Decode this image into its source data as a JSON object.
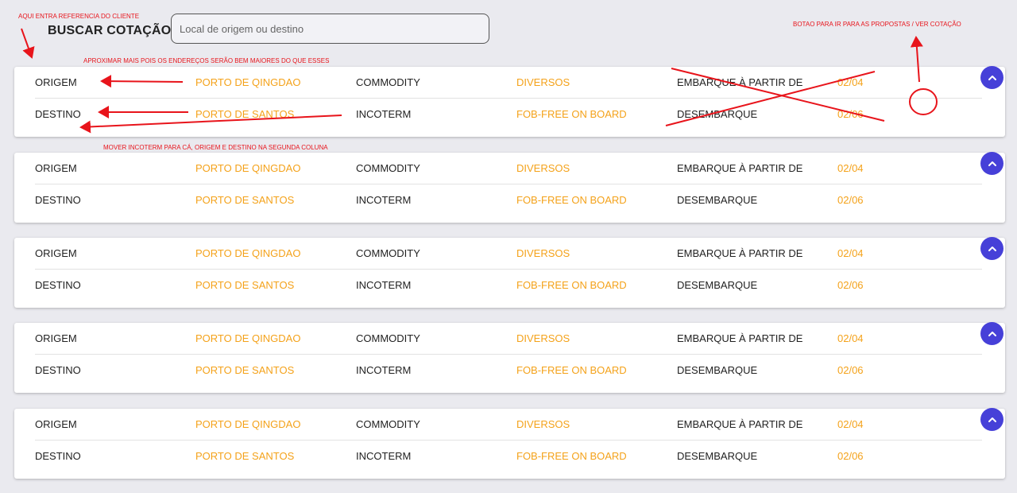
{
  "header": {
    "title": "BUSCAR COTAÇÃO",
    "search_placeholder": "Local de origem ou destino"
  },
  "cards": [
    {
      "origem_label": "ORIGEM",
      "origem_value": "PORTO DE QINGDAO",
      "commodity_label": "COMMODITY",
      "commodity_value": "DIVERSOS",
      "embarque_label": "EMBARQUE À PARTIR DE",
      "embarque_value": "02/04",
      "destino_label": "DESTINO",
      "destino_value": "PORTO DE SANTOS",
      "incoterm_label": "INCOTERM",
      "incoterm_value": "FOB-FREE ON BOARD",
      "desembarque_label": "DESEMBARQUE",
      "desembarque_value": "02/06",
      "expand_icon": "chevron-up-icon"
    },
    {
      "origem_label": "ORIGEM",
      "origem_value": "PORTO DE QINGDAO",
      "commodity_label": "COMMODITY",
      "commodity_value": "DIVERSOS",
      "embarque_label": "EMBARQUE À PARTIR DE",
      "embarque_value": "02/04",
      "destino_label": "DESTINO",
      "destino_value": "PORTO DE SANTOS",
      "incoterm_label": "INCOTERM",
      "incoterm_value": "FOB-FREE ON BOARD",
      "desembarque_label": "DESEMBARQUE",
      "desembarque_value": "02/06",
      "expand_icon": "chevron-up-icon"
    },
    {
      "origem_label": "ORIGEM",
      "origem_value": "PORTO DE QINGDAO",
      "commodity_label": "COMMODITY",
      "commodity_value": "DIVERSOS",
      "embarque_label": "EMBARQUE À PARTIR DE",
      "embarque_value": "02/04",
      "destino_label": "DESTINO",
      "destino_value": "PORTO DE SANTOS",
      "incoterm_label": "INCOTERM",
      "incoterm_value": "FOB-FREE ON BOARD",
      "desembarque_label": "DESEMBARQUE",
      "desembarque_value": "02/06",
      "expand_icon": "chevron-up-icon"
    },
    {
      "origem_label": "ORIGEM",
      "origem_value": "PORTO DE QINGDAO",
      "commodity_label": "COMMODITY",
      "commodity_value": "DIVERSOS",
      "embarque_label": "EMBARQUE À PARTIR DE",
      "embarque_value": "02/04",
      "destino_label": "DESTINO",
      "destino_value": "PORTO DE SANTOS",
      "incoterm_label": "INCOTERM",
      "incoterm_value": "FOB-FREE ON BOARD",
      "desembarque_label": "DESEMBARQUE",
      "desembarque_value": "02/06",
      "expand_icon": "chevron-up-icon"
    },
    {
      "origem_label": "ORIGEM",
      "origem_value": "PORTO DE QINGDAO",
      "commodity_label": "COMMODITY",
      "commodity_value": "DIVERSOS",
      "embarque_label": "EMBARQUE À PARTIR DE",
      "embarque_value": "02/04",
      "destino_label": "DESTINO",
      "destino_value": "PORTO DE SANTOS",
      "incoterm_label": "INCOTERM",
      "incoterm_value": "FOB-FREE ON BOARD",
      "desembarque_label": "DESEMBARQUE",
      "desembarque_value": "02/06",
      "expand_icon": "chevron-up-icon"
    }
  ],
  "annotations": {
    "client_reference": "AQUI ENTRA REFERENCIA DO CLIENTE",
    "proposals_button": "BOTAO PARA IR PARA AS PROPOSTAS / VER COTAÇÃO",
    "bring_closer": "APROXIMAR MAIS POIS OS ENDEREÇOS SERÃO BEM MAIORES DO QUE ESSES",
    "move_incoterm": "MOVER INCOTERM PARA CÁ, ORIGEM E DESTINO NA SEGUNDA COLUNA"
  },
  "colors": {
    "background": "#eaeaef",
    "value_text": "#f4a21a",
    "label_text": "#222222",
    "accent_button": "#4640d8",
    "annotation": "#e8141b"
  }
}
